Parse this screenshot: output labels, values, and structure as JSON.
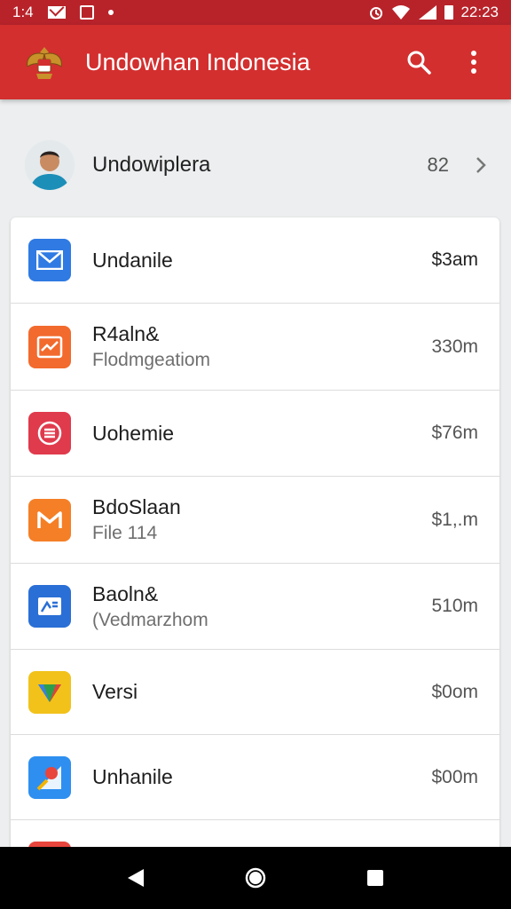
{
  "status_bar": {
    "left_text": "1:4",
    "time": "22:23"
  },
  "app_bar": {
    "title": "Undowhan Indonesia"
  },
  "profile": {
    "name": "Undowiplera",
    "count": "82"
  },
  "items": [
    {
      "title": "Undanile",
      "subtitle": "",
      "meta": "$3am",
      "icon": "mail-icon",
      "color": "#2f7ae3"
    },
    {
      "title": "R4aln&",
      "subtitle": "Flodmgeatiom",
      "meta": "330m",
      "icon": "trend-icon",
      "color": "#f26a2d"
    },
    {
      "title": "Uohemie",
      "subtitle": "",
      "meta": "$76m",
      "icon": "list-icon",
      "color": "#e03a4d"
    },
    {
      "title": "BdoSlaan",
      "subtitle": "File 114",
      "meta": "$1,.m",
      "icon": "gmail-icon",
      "color": "#f57f26"
    },
    {
      "title": "Baoln&",
      "subtitle": "(Vedmarzhom",
      "meta": "510m",
      "icon": "photo-icon",
      "color": "#2a6fd6"
    },
    {
      "title": "Versi",
      "subtitle": "",
      "meta": "$0om",
      "icon": "play-icon",
      "color": "#f2c21b"
    },
    {
      "title": "Unhanile",
      "subtitle": "",
      "meta": "$00m",
      "icon": "maps-icon",
      "color": "#2e8ff0"
    },
    {
      "title": "",
      "subtitle": "",
      "meta": "",
      "icon": "partial-icon",
      "color": "#e8453c"
    }
  ]
}
